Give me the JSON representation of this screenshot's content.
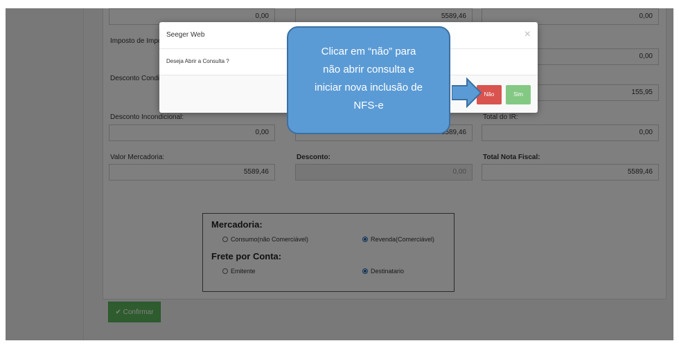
{
  "form": {
    "row0": {
      "col1": "0,00",
      "col2": "5589,46",
      "col3": "0,00"
    },
    "row1": {
      "label1": "Imposto de Impor",
      "col3": "0,00"
    },
    "row2": {
      "label1": "Desconto Condici",
      "col3": "155,95"
    },
    "row3": {
      "label1": "Desconto Incondicional:",
      "label3": "Total do IR:",
      "col1": "0,00",
      "col2": "5589,46",
      "col3": "0,00"
    },
    "row4": {
      "label1": "Valor Mercadoria:",
      "label2": "Desconto:",
      "label3": "Total Nota Fiscal:",
      "col1": "5589,46",
      "col2": "0,00",
      "col3": "5589,46"
    }
  },
  "options": {
    "mercadoria": {
      "title": "Mercadoria:",
      "opt1": "Consumo(não Comerciável)",
      "opt2": "Revenda(Comerciável)",
      "selected": "opt2"
    },
    "frete": {
      "title": "Frete por Conta:",
      "opt1": "Emitente",
      "opt2": "Destinatario",
      "selected": "opt2"
    }
  },
  "confirm_label": "✔ Confirmar",
  "modal": {
    "title": "Seeger Web",
    "close_icon": "×",
    "message": "Deseja Abrir a Consulta ?",
    "no_label": "Não",
    "yes_label": "Sim"
  },
  "callout": {
    "lines": [
      "Clicar em “não” para",
      "não abrir consulta e",
      "iniciar nova inclusão de",
      "NFS-e"
    ],
    "color": "#5b9bd5"
  },
  "colors": {
    "danger": "#d9534f",
    "success": "#5cb85c",
    "accent": "#1e67b3"
  }
}
